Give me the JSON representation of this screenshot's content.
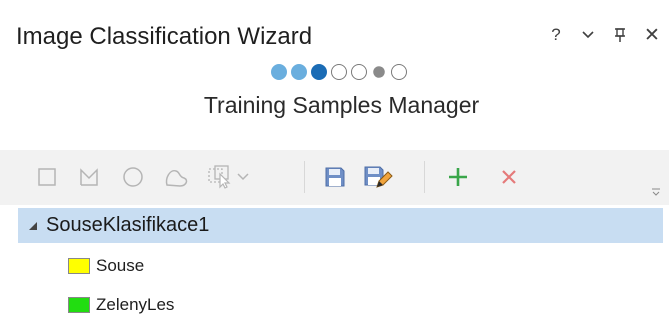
{
  "window": {
    "title": "Image Classification Wizard",
    "controls": {
      "help": "?",
      "menu_icon": "chevron-down-icon",
      "pin_icon": "pin-icon",
      "close": "✕"
    }
  },
  "wizard": {
    "steps_total": 7,
    "current_step": 3,
    "step_states": [
      "done",
      "done",
      "current",
      "empty",
      "empty",
      "filled-gray",
      "empty"
    ],
    "page_title": "Training Samples Manager"
  },
  "toolbar": {
    "tools": [
      {
        "name": "rectangle-tool",
        "icon": "rectangle-icon",
        "enabled": false
      },
      {
        "name": "polygon-tool",
        "icon": "polygon-icon",
        "enabled": false
      },
      {
        "name": "circle-tool",
        "icon": "circle-icon",
        "enabled": false
      },
      {
        "name": "freehand-tool",
        "icon": "freehand-icon",
        "enabled": false
      },
      {
        "name": "select-tool",
        "icon": "select-icon",
        "enabled": false
      },
      {
        "name": "save-tool",
        "icon": "save-icon",
        "enabled": true
      },
      {
        "name": "save-as-tool",
        "icon": "save-as-icon",
        "enabled": true
      },
      {
        "name": "add-class-tool",
        "icon": "plus-icon",
        "enabled": true
      },
      {
        "name": "remove-class-tool",
        "icon": "x-icon",
        "enabled": true
      }
    ],
    "colors": {
      "disabled": "#b5b5b5",
      "save": "#5a7db8",
      "add": "#3aa64a",
      "remove": "#e57a7a"
    }
  },
  "schema": {
    "group": {
      "label": "SouseKlasifikace1",
      "expanded": true
    },
    "classes": [
      {
        "label": "Souse",
        "color": "#ffff00"
      },
      {
        "label": "ZelenyLes",
        "color": "#22dd11"
      }
    ],
    "selection_color": "#c8ddf2"
  }
}
